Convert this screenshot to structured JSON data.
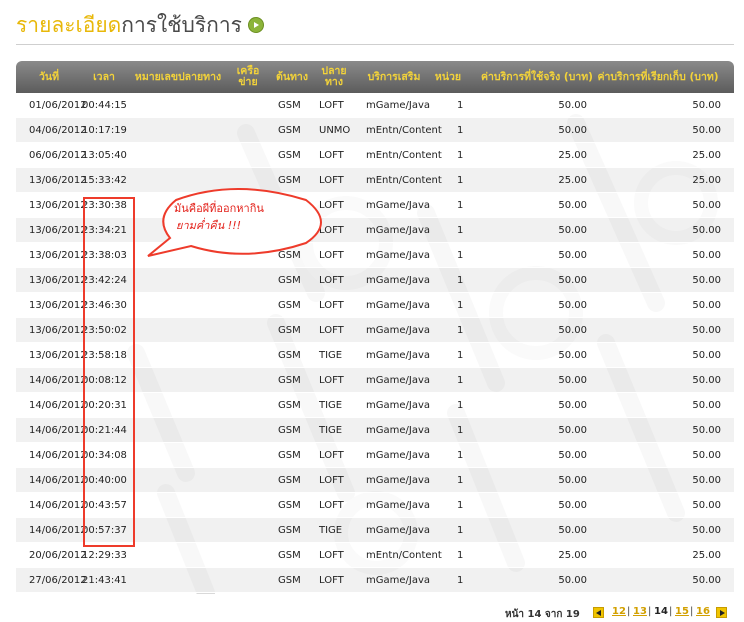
{
  "page": {
    "title_part1": "รายละเอียด",
    "title_part2": "การใช้บริการ"
  },
  "table": {
    "headers": {
      "date": "วันที่",
      "time": "เวลา",
      "phone": "หมายเลขปลายทาง",
      "network": "เครือข่าย",
      "origin": "ต้นทาง",
      "destination": "ปลายทาง",
      "service": "บริการเสริม",
      "unit": "หน่วย",
      "charge_used": "ค่าบริการที่ใช้จริง (บาท)",
      "charge_billed": "ค่าบริการที่เรียกเก็บ (บาท)"
    },
    "rows": [
      {
        "date": "01/06/2012",
        "time": "00:44:15",
        "origin": "GSM",
        "dest": "LOFT",
        "service": "mGame/Java",
        "unit": "1",
        "used": "50.00",
        "billed": "50.00"
      },
      {
        "date": "04/06/2012",
        "time": "10:17:19",
        "origin": "GSM",
        "dest": "UNMO",
        "service": "mEntn/Content",
        "unit": "1",
        "used": "50.00",
        "billed": "50.00"
      },
      {
        "date": "06/06/2012",
        "time": "13:05:40",
        "origin": "GSM",
        "dest": "LOFT",
        "service": "mEntn/Content",
        "unit": "1",
        "used": "25.00",
        "billed": "25.00"
      },
      {
        "date": "13/06/2012",
        "time": "15:33:42",
        "origin": "GSM",
        "dest": "LOFT",
        "service": "mEntn/Content",
        "unit": "1",
        "used": "25.00",
        "billed": "25.00"
      },
      {
        "date": "13/06/2012",
        "time": "23:30:38",
        "origin": "GSM",
        "dest": "LOFT",
        "service": "mGame/Java",
        "unit": "1",
        "used": "50.00",
        "billed": "50.00"
      },
      {
        "date": "13/06/2012",
        "time": "23:34:21",
        "origin": "GSM",
        "dest": "LOFT",
        "service": "mGame/Java",
        "unit": "1",
        "used": "50.00",
        "billed": "50.00"
      },
      {
        "date": "13/06/2012",
        "time": "23:38:03",
        "origin": "GSM",
        "dest": "LOFT",
        "service": "mGame/Java",
        "unit": "1",
        "used": "50.00",
        "billed": "50.00"
      },
      {
        "date": "13/06/2012",
        "time": "23:42:24",
        "origin": "GSM",
        "dest": "LOFT",
        "service": "mGame/Java",
        "unit": "1",
        "used": "50.00",
        "billed": "50.00"
      },
      {
        "date": "13/06/2012",
        "time": "23:46:30",
        "origin": "GSM",
        "dest": "LOFT",
        "service": "mGame/Java",
        "unit": "1",
        "used": "50.00",
        "billed": "50.00"
      },
      {
        "date": "13/06/2012",
        "time": "23:50:02",
        "origin": "GSM",
        "dest": "LOFT",
        "service": "mGame/Java",
        "unit": "1",
        "used": "50.00",
        "billed": "50.00"
      },
      {
        "date": "13/06/2012",
        "time": "23:58:18",
        "origin": "GSM",
        "dest": "TIGE",
        "service": "mGame/Java",
        "unit": "1",
        "used": "50.00",
        "billed": "50.00"
      },
      {
        "date": "14/06/2012",
        "time": "00:08:12",
        "origin": "GSM",
        "dest": "LOFT",
        "service": "mGame/Java",
        "unit": "1",
        "used": "50.00",
        "billed": "50.00"
      },
      {
        "date": "14/06/2012",
        "time": "00:20:31",
        "origin": "GSM",
        "dest": "TIGE",
        "service": "mGame/Java",
        "unit": "1",
        "used": "50.00",
        "billed": "50.00"
      },
      {
        "date": "14/06/2012",
        "time": "00:21:44",
        "origin": "GSM",
        "dest": "TIGE",
        "service": "mGame/Java",
        "unit": "1",
        "used": "50.00",
        "billed": "50.00"
      },
      {
        "date": "14/06/2012",
        "time": "00:34:08",
        "origin": "GSM",
        "dest": "LOFT",
        "service": "mGame/Java",
        "unit": "1",
        "used": "50.00",
        "billed": "50.00"
      },
      {
        "date": "14/06/2012",
        "time": "00:40:00",
        "origin": "GSM",
        "dest": "LOFT",
        "service": "mGame/Java",
        "unit": "1",
        "used": "50.00",
        "billed": "50.00"
      },
      {
        "date": "14/06/2012",
        "time": "00:43:57",
        "origin": "GSM",
        "dest": "LOFT",
        "service": "mGame/Java",
        "unit": "1",
        "used": "50.00",
        "billed": "50.00"
      },
      {
        "date": "14/06/2012",
        "time": "00:57:37",
        "origin": "GSM",
        "dest": "TIGE",
        "service": "mGame/Java",
        "unit": "1",
        "used": "50.00",
        "billed": "50.00"
      },
      {
        "date": "20/06/2012",
        "time": "12:29:33",
        "origin": "GSM",
        "dest": "LOFT",
        "service": "mEntn/Content",
        "unit": "1",
        "used": "25.00",
        "billed": "25.00"
      },
      {
        "date": "27/06/2012",
        "time": "21:43:41",
        "origin": "GSM",
        "dest": "LOFT",
        "service": "mGame/Java",
        "unit": "1",
        "used": "50.00",
        "billed": "50.00"
      }
    ]
  },
  "annotation": {
    "line1": "มันคือผีที่ออกหากิน",
    "line2": "ยามค่ำคืน  !!!"
  },
  "pagination": {
    "info": "หน้า 14 จาก 19",
    "pages": [
      "12",
      "13",
      "14",
      "15",
      "16"
    ],
    "current": "14",
    "separator": "|"
  },
  "colors": {
    "accent": "#e8b80a",
    "header_text": "#f2d23a",
    "annotation": "#ee3b2b"
  }
}
